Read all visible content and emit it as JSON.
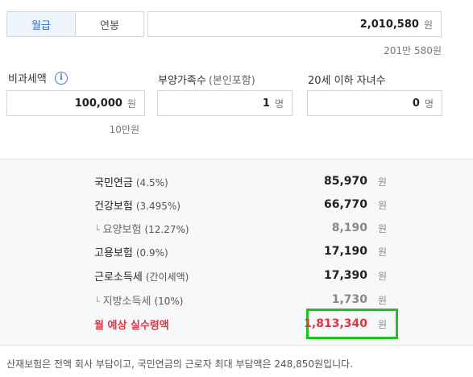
{
  "toggle": {
    "monthly": "월급",
    "annual": "연봉"
  },
  "salary": {
    "value": "2,010,580",
    "unit": "원",
    "hint": "201만 580원"
  },
  "inputs": {
    "nontax": {
      "label": "비과세액",
      "value": "100,000",
      "unit": "원",
      "hint": "10만원"
    },
    "dependents": {
      "label": "부양가족수",
      "label_sub": "(본인포함)",
      "value": "1",
      "unit": "명"
    },
    "children": {
      "label": "20세 이하 자녀수",
      "value": "0",
      "unit": "명"
    }
  },
  "deductions": [
    {
      "label": "국민연금",
      "rate": "(4.5%)",
      "value": "85,970",
      "unit": "원"
    },
    {
      "label": "건강보험",
      "rate": "(3.495%)",
      "value": "66,770",
      "unit": "원"
    },
    {
      "label": "요양보험",
      "rate": "(12.27%)",
      "value": "8,190",
      "unit": "원"
    },
    {
      "label": "고용보험",
      "rate": "(0.9%)",
      "value": "17,190",
      "unit": "원"
    },
    {
      "label": "근로소득세",
      "rate": "(간이세액)",
      "value": "17,390",
      "unit": "원"
    },
    {
      "label": "지방소득세",
      "rate": "(10%)",
      "value": "1,730",
      "unit": "원"
    }
  ],
  "net": {
    "label": "월 예상 실수령액",
    "value": "1,813,340",
    "unit": "원"
  },
  "footnote": "산재보험은 전액 회사 부담이고, 국민연금의 근로자 최대 부담액은 248,850원입니다."
}
